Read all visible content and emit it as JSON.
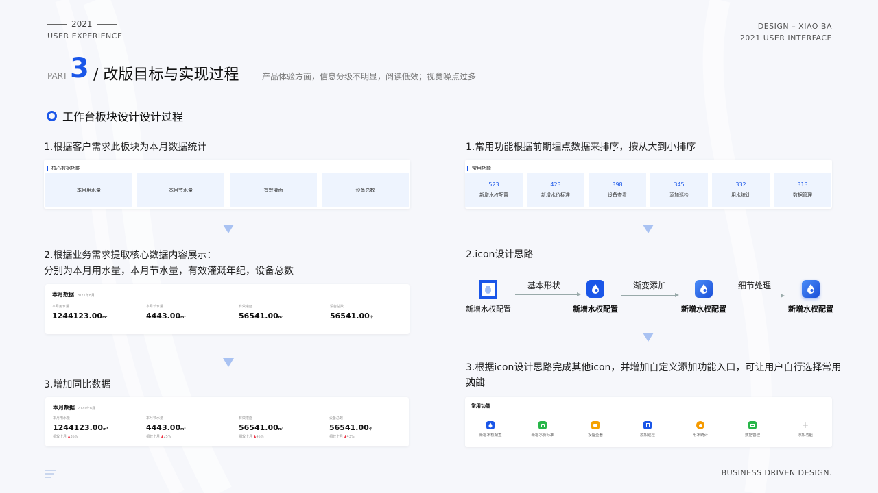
{
  "header": {
    "year": "2021",
    "subtitle_left": "USER EXPERIENCE",
    "right_line1": "DESIGN – XIAO BA",
    "right_line2": "2021 USER INTERFACE",
    "part_label": "PART",
    "part_number": "3",
    "title": "/ 改版目标与实现过程",
    "title_sub": "产品体验方面，信息分级不明显，阅读低效；视觉噪点过多"
  },
  "section_title": "工作台板块设计设计过程",
  "left": {
    "step1": "1.根据客户需求此板块为本月数据统计",
    "card1": {
      "title": "核心数据功能",
      "tiles": [
        "本月用水量",
        "本月节水量",
        "有效灌面",
        "设备总数"
      ]
    },
    "step2_line1": "2.根据业务需求提取核心数据内容展示：",
    "step2_line2": "分别为本月用水量，本月节水量，有效灌溉年纪，设备总数",
    "card2": {
      "title": "本月数据",
      "date": "2021年8月",
      "stats": [
        {
          "label": "本月用水量",
          "value": "1244123.00",
          "unit": "m³"
        },
        {
          "label": "本月节水量",
          "value": "4443.00",
          "unit": "m³"
        },
        {
          "label": "有效灌面",
          "value": "56541.00",
          "unit": "m³"
        },
        {
          "label": "设备总数",
          "value": "56541.00",
          "unit": "个"
        }
      ]
    },
    "step3": "3.增加同比数据",
    "card3": {
      "title": "本月数据",
      "date": "2021年8月",
      "stats": [
        {
          "label": "本月用水量",
          "value": "1244123.00",
          "unit": "m³",
          "cmp": "相较上月",
          "pct": "35%"
        },
        {
          "label": "本月节水量",
          "value": "4443.00",
          "unit": "m³",
          "cmp": "相较上月",
          "pct": "25%"
        },
        {
          "label": "有效灌面",
          "value": "56541.00",
          "unit": "m³",
          "cmp": "相较上月",
          "pct": "45%"
        },
        {
          "label": "设备总数",
          "value": "56541.00",
          "unit": "个",
          "cmp": "相较上月",
          "pct": "43%"
        }
      ]
    }
  },
  "right": {
    "step1": "1.常用功能根据前期埋点数据来排序，按从大到小排序",
    "card1": {
      "title": "常用功能",
      "tiles": [
        {
          "num": "523",
          "label": "新增水权配置"
        },
        {
          "num": "423",
          "label": "新增水价标准"
        },
        {
          "num": "398",
          "label": "设备查看"
        },
        {
          "num": "345",
          "label": "添加巡检"
        },
        {
          "num": "332",
          "label": "用水统计"
        },
        {
          "num": "313",
          "label": "数据管理"
        }
      ]
    },
    "step2": "2.icon设计思路",
    "flow": {
      "stages": [
        "新增水权配置",
        "新增水权配置",
        "新增水权配置",
        "新增水权配置"
      ],
      "arrows": [
        "基本形状",
        "渐变添加",
        "细节处理"
      ]
    },
    "step3_line1": "3.根据icon设计思路完成其他icon，并增加自定义添加功能入口，可让用户自行选择常用功能",
    "step3_line2": "入口",
    "card3": {
      "title": "常用功能",
      "items": [
        {
          "label": "新增水权配置",
          "color": "#1a56e8",
          "icon": "water-drop-icon"
        },
        {
          "label": "新增水价标准",
          "color": "#27b648",
          "icon": "price-tag-icon"
        },
        {
          "label": "设备查看",
          "color": "#f5a200",
          "icon": "device-icon"
        },
        {
          "label": "添加巡检",
          "color": "#1a56e8",
          "icon": "inspection-icon"
        },
        {
          "label": "用水统计",
          "color": "#f59a00",
          "icon": "pie-chart-icon"
        },
        {
          "label": "数据管理",
          "color": "#27b648",
          "icon": "folder-icon"
        },
        {
          "label": "添加功能",
          "color": "#cccccc",
          "icon": "plus-icon"
        }
      ]
    }
  },
  "footer": {
    "right": "BUSINESS DRIVEN DESIGN."
  },
  "colors": {
    "accent": "#1a56e8",
    "background": "#f6f7fb"
  }
}
